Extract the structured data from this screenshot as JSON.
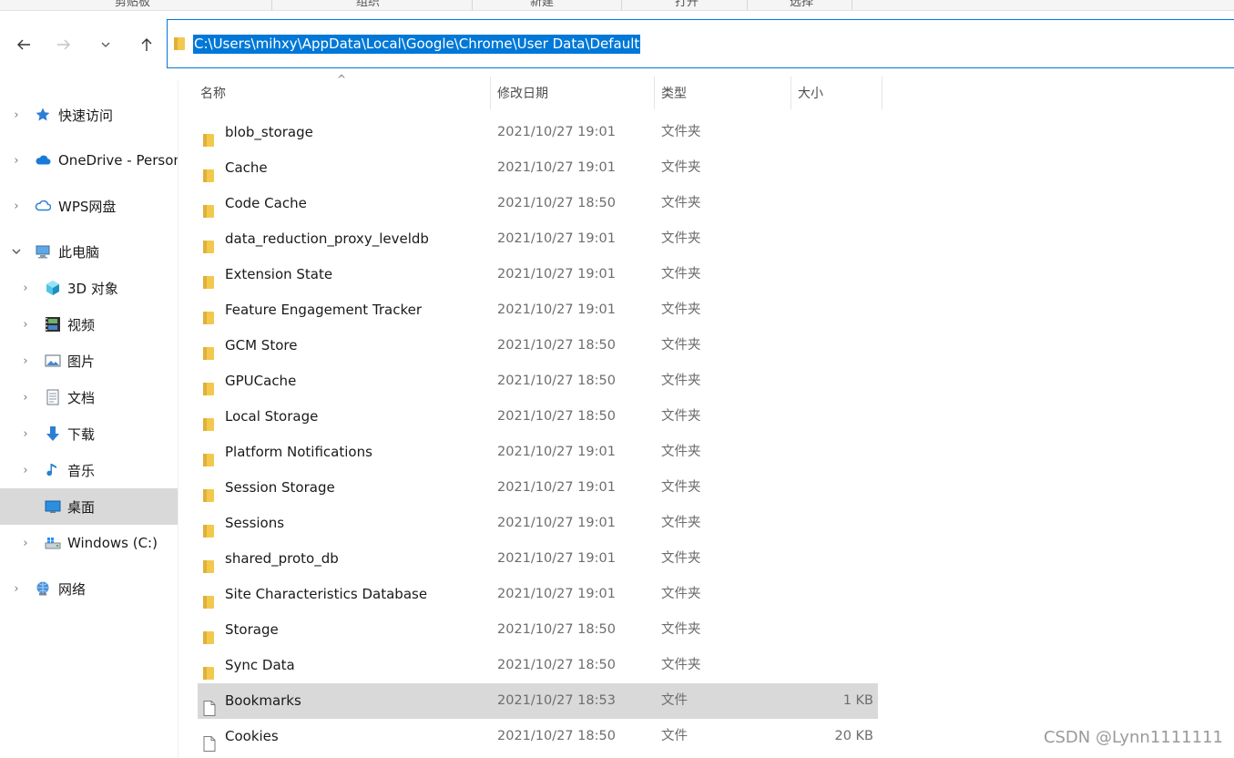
{
  "ribbon": {
    "groups": [
      "剪贴板",
      "组织",
      "新建",
      "打开",
      "选择"
    ]
  },
  "nav": {
    "back_icon": "arrow-left-icon",
    "forward_icon": "arrow-right-icon",
    "recent_icon": "chevron-down-icon",
    "up_icon": "arrow-up-icon"
  },
  "address": {
    "path": "C:\\Users\\mihxy\\AppData\\Local\\Google\\Chrome\\User Data\\Default"
  },
  "sidebar": {
    "items": [
      {
        "label": "快速访问",
        "icon": "star-icon",
        "expander": "collapsed"
      },
      {
        "label": "OneDrive - Personal",
        "icon": "cloud-icon",
        "expander": "collapsed"
      },
      {
        "label": "WPS网盘",
        "icon": "cloud-outline-icon",
        "expander": "collapsed"
      },
      {
        "label": "此电脑",
        "icon": "computer-icon",
        "expander": "expanded"
      },
      {
        "label": "3D 对象",
        "icon": "cube-icon",
        "expander": "collapsed"
      },
      {
        "label": "视频",
        "icon": "film-icon",
        "expander": "collapsed"
      },
      {
        "label": "图片",
        "icon": "picture-icon",
        "expander": "collapsed"
      },
      {
        "label": "文档",
        "icon": "document-icon",
        "expander": "collapsed"
      },
      {
        "label": "下载",
        "icon": "download-arrow-icon",
        "expander": "collapsed"
      },
      {
        "label": "音乐",
        "icon": "music-note-icon",
        "expander": "collapsed"
      },
      {
        "label": "桌面",
        "icon": "desktop-icon",
        "expander": "none",
        "selected": true
      },
      {
        "label": "Windows (C:)",
        "icon": "drive-icon",
        "expander": "collapsed"
      },
      {
        "label": "网络",
        "icon": "network-icon",
        "expander": "collapsed"
      }
    ]
  },
  "columns": {
    "name": "名称",
    "date": "修改日期",
    "type": "类型",
    "size": "大小"
  },
  "files": [
    {
      "name": "blob_storage",
      "date": "2021/10/27 19:01",
      "type": "文件夹",
      "size": "",
      "kind": "folder"
    },
    {
      "name": "Cache",
      "date": "2021/10/27 19:01",
      "type": "文件夹",
      "size": "",
      "kind": "folder"
    },
    {
      "name": "Code Cache",
      "date": "2021/10/27 18:50",
      "type": "文件夹",
      "size": "",
      "kind": "folder"
    },
    {
      "name": "data_reduction_proxy_leveldb",
      "date": "2021/10/27 19:01",
      "type": "文件夹",
      "size": "",
      "kind": "folder"
    },
    {
      "name": "Extension State",
      "date": "2021/10/27 19:01",
      "type": "文件夹",
      "size": "",
      "kind": "folder"
    },
    {
      "name": "Feature Engagement Tracker",
      "date": "2021/10/27 19:01",
      "type": "文件夹",
      "size": "",
      "kind": "folder"
    },
    {
      "name": "GCM Store",
      "date": "2021/10/27 18:50",
      "type": "文件夹",
      "size": "",
      "kind": "folder"
    },
    {
      "name": "GPUCache",
      "date": "2021/10/27 18:50",
      "type": "文件夹",
      "size": "",
      "kind": "folder"
    },
    {
      "name": "Local Storage",
      "date": "2021/10/27 18:50",
      "type": "文件夹",
      "size": "",
      "kind": "folder"
    },
    {
      "name": "Platform Notifications",
      "date": "2021/10/27 19:01",
      "type": "文件夹",
      "size": "",
      "kind": "folder"
    },
    {
      "name": "Session Storage",
      "date": "2021/10/27 19:01",
      "type": "文件夹",
      "size": "",
      "kind": "folder"
    },
    {
      "name": "Sessions",
      "date": "2021/10/27 19:01",
      "type": "文件夹",
      "size": "",
      "kind": "folder"
    },
    {
      "name": "shared_proto_db",
      "date": "2021/10/27 19:01",
      "type": "文件夹",
      "size": "",
      "kind": "folder"
    },
    {
      "name": "Site Characteristics Database",
      "date": "2021/10/27 19:01",
      "type": "文件夹",
      "size": "",
      "kind": "folder"
    },
    {
      "name": "Storage",
      "date": "2021/10/27 18:50",
      "type": "文件夹",
      "size": "",
      "kind": "folder"
    },
    {
      "name": "Sync Data",
      "date": "2021/10/27 18:50",
      "type": "文件夹",
      "size": "",
      "kind": "folder"
    },
    {
      "name": "Bookmarks",
      "date": "2021/10/27 18:53",
      "type": "文件",
      "size": "1 KB",
      "kind": "file",
      "selected": true
    },
    {
      "name": "Cookies",
      "date": "2021/10/27 18:50",
      "type": "文件",
      "size": "20 KB",
      "kind": "file"
    }
  ],
  "watermark": "CSDN @Lynn1111111",
  "colors": {
    "accent": "#0078d7",
    "selection": "#d9d9d9",
    "folder": "#f2c94c"
  }
}
